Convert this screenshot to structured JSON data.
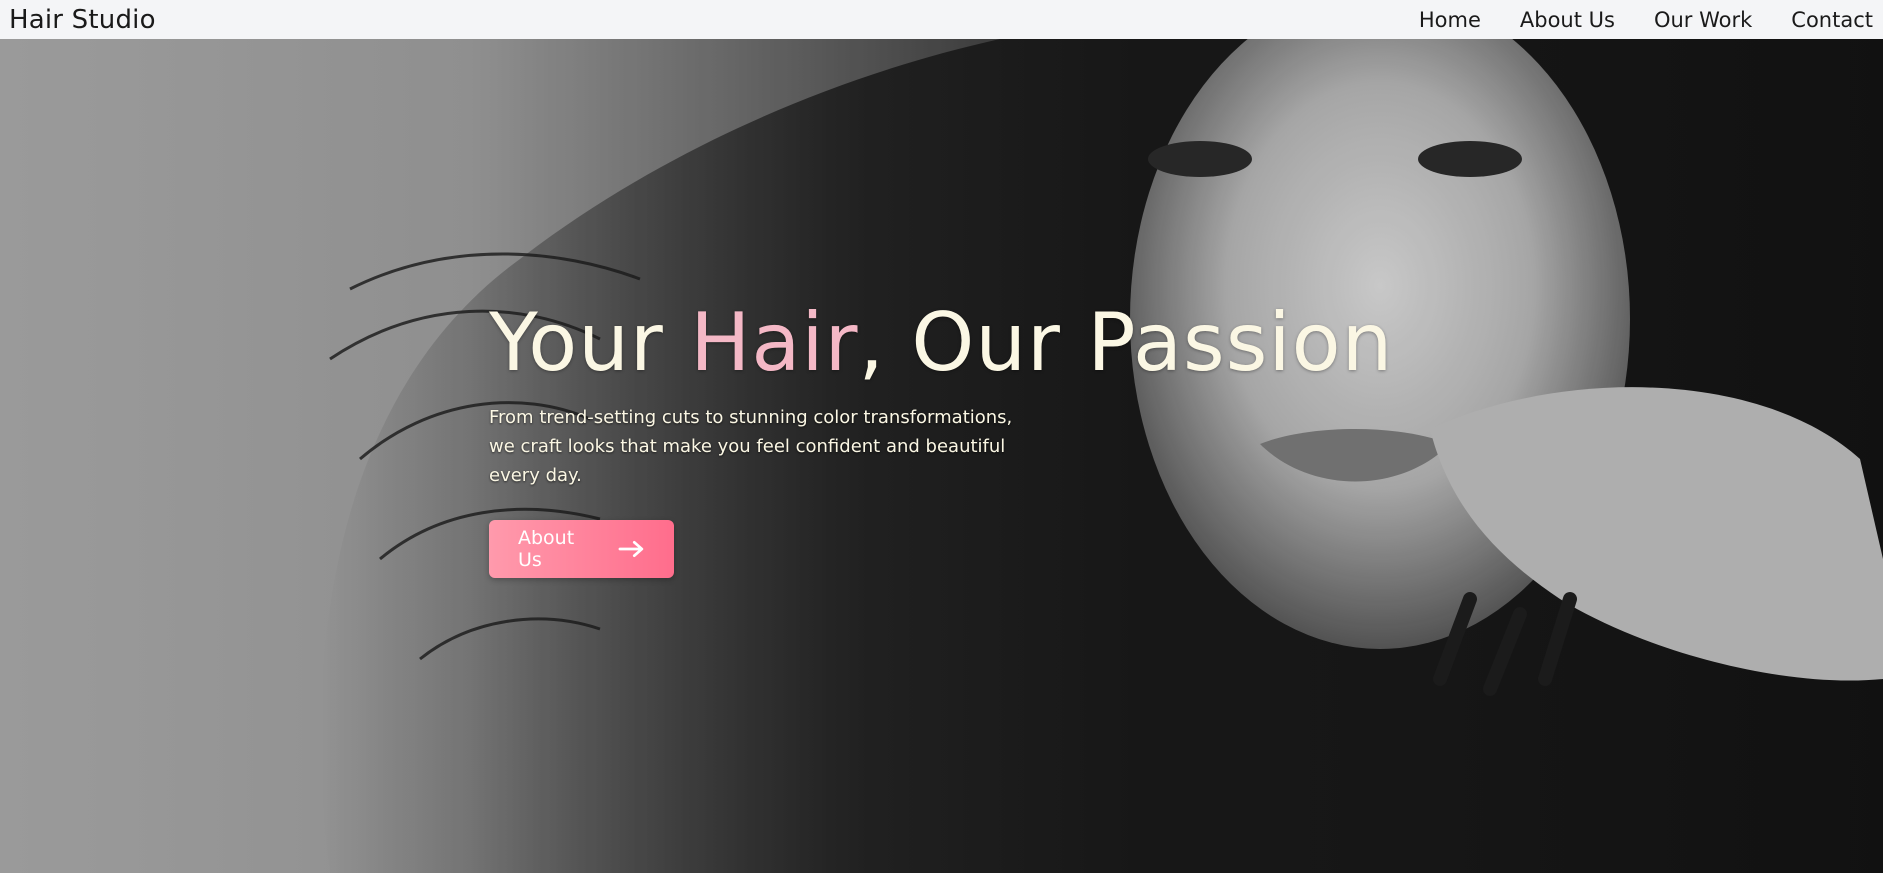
{
  "nav": {
    "brand": "Hair Studio",
    "links": [
      {
        "label": "Home"
      },
      {
        "label": "About Us"
      },
      {
        "label": "Our Work"
      },
      {
        "label": "Contact"
      }
    ]
  },
  "hero": {
    "title_part1": "Your ",
    "title_accent": "Hair",
    "title_part2": ", Our Passion",
    "subtitle": "From trend-setting cuts to stunning color transformations, we craft looks that make you feel confident and beautiful every day.",
    "cta_label": "About Us",
    "cta_icon": "arrow-right-icon",
    "background_image": "black-and-white portrait of a woman with long curly hair"
  },
  "colors": {
    "nav_bg": "#f4f5f7",
    "title_text": "#fbf7e4",
    "title_accent": "#f4b8c6",
    "cta_start": "#ff9aac",
    "cta_end": "#ff6d8c"
  }
}
